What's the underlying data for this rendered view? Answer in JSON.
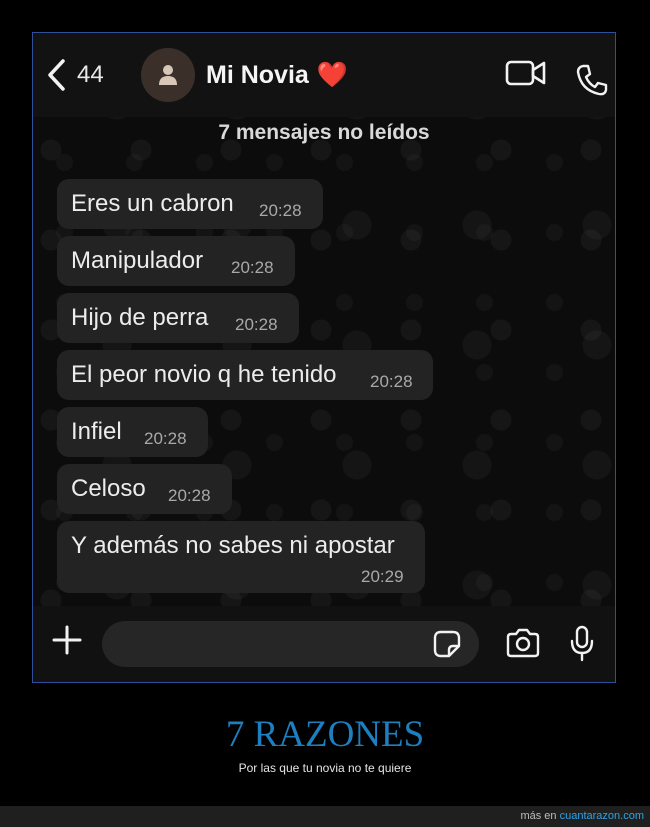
{
  "header": {
    "back_count": "44",
    "contact_name": "Mi Novia",
    "heart": "❤️"
  },
  "chat": {
    "unread_banner": "7 mensajes no leídos",
    "messages": [
      {
        "text": "Eres un cabron",
        "time": "20:28"
      },
      {
        "text": "Manipulador",
        "time": "20:28"
      },
      {
        "text": "Hijo de perra",
        "time": "20:28"
      },
      {
        "text": "El peor novio q he tenido",
        "time": "20:28"
      },
      {
        "text": "Infiel",
        "time": "20:28"
      },
      {
        "text": "Celoso",
        "time": "20:28"
      },
      {
        "text": "Y además no sabes ni apostar",
        "time": "20:29"
      }
    ]
  },
  "input": {
    "value": "",
    "icons": [
      "plus-icon",
      "sticker-icon",
      "camera-icon",
      "mic-icon"
    ]
  },
  "caption": {
    "title": "7 RAZONES",
    "subtitle": "Por las que tu novia no te quiere"
  },
  "footer": {
    "prefix": "más en",
    "link": "cuantarazon.com"
  },
  "colors": {
    "caption_title": "#1e7fc0",
    "frame_border": "#2f4f9a",
    "bubble": "#232323",
    "link": "#2ea3e6"
  }
}
